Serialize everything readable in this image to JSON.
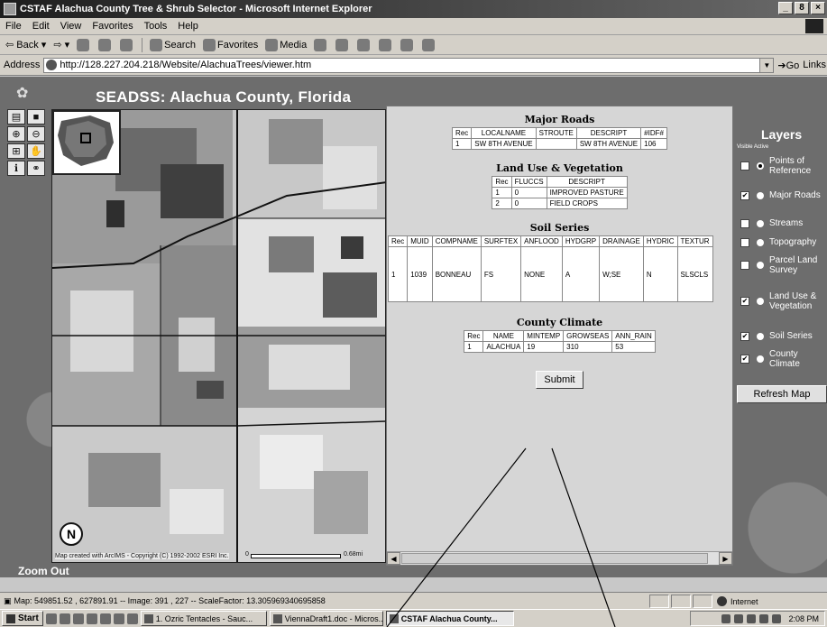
{
  "window": {
    "title": "CSTAF Alachua County Tree & Shrub Selector - Microsoft Internet Explorer",
    "controls": [
      "_",
      "8",
      "×"
    ]
  },
  "menu": [
    "File",
    "Edit",
    "View",
    "Favorites",
    "Tools",
    "Help"
  ],
  "toolbar": {
    "back": "Back",
    "search": "Search",
    "favorites": "Favorites",
    "media": "Media"
  },
  "address": {
    "label": "Address",
    "url": "http://128.227.204.218/Website/AlachuaTrees/viewer.htm",
    "go": "Go",
    "links": "Links"
  },
  "site": {
    "title": "SEADSS:  Alachua County, Florida"
  },
  "map": {
    "north": "N",
    "copyright": "Map created with ArcIMS - Copyright (C) 1992-2002 ESRI Inc.",
    "scale_start": "0",
    "scale_label": "0.68mi",
    "zoom_label": "Zoom Out"
  },
  "results": {
    "major_roads": {
      "title": "Major Roads",
      "headers": [
        "Rec",
        "LOCALNAME",
        "STROUTE",
        "DESCRIPT",
        "#IDF#"
      ],
      "rows": [
        [
          "1",
          "SW 8TH AVENUE",
          "",
          "SW 8TH AVENUE",
          "106"
        ]
      ]
    },
    "land_use": {
      "title": "Land Use & Vegetation",
      "headers": [
        "Rec",
        "FLUCCS",
        "DESCRIPT"
      ],
      "rows": [
        [
          "1",
          "0",
          "IMPROVED PASTURE"
        ],
        [
          "2",
          "0",
          "FIELD CROPS"
        ]
      ]
    },
    "soil": {
      "title": "Soil Series",
      "headers": [
        "Rec",
        "MUID",
        "COMPNAME",
        "SURFTEX",
        "ANFLOOD",
        "HYDGRP",
        "DRAINAGE",
        "HYDRIC",
        "TEXTUR"
      ],
      "rows": [
        [
          "1",
          "1039",
          "BONNEAU",
          "FS",
          "NONE",
          "A",
          "W;SE",
          "N",
          "SLSCLS"
        ]
      ]
    },
    "climate": {
      "title": "County Climate",
      "headers": [
        "Rec",
        "NAME",
        "MINTEMP",
        "GROWSEAS",
        "ANN_RAIN"
      ],
      "rows": [
        [
          "1",
          "ALACHUA",
          "19",
          "310",
          "53"
        ]
      ]
    },
    "submit": "Submit"
  },
  "layers": {
    "title": "Layers",
    "subtitle": "Visible Active",
    "items": [
      {
        "label": "Points of Reference",
        "visible": false,
        "active": true
      },
      {
        "label": "Major Roads",
        "visible": true,
        "active": false
      },
      {
        "label": "Streams",
        "visible": false,
        "active": false
      },
      {
        "label": "Topography",
        "visible": false,
        "active": false
      },
      {
        "label": "Parcel Land Survey",
        "visible": false,
        "active": false
      },
      {
        "label": "Land Use & Vegetation",
        "visible": true,
        "active": false
      },
      {
        "label": "Soil Series",
        "visible": true,
        "active": false
      },
      {
        "label": "County Climate",
        "visible": true,
        "active": false
      }
    ],
    "refresh": "Refresh Map"
  },
  "status": {
    "text": "Map: 549851.52 , 627891.91 -- Image: 391 , 227 -- ScaleFactor: 13.305969340695858",
    "zone": "Internet"
  },
  "taskbar": {
    "start": "Start",
    "tasks": [
      "1. Ozric Tentacles - Sauc...",
      "ViennaDraft1.doc - Micros...",
      "CSTAF Alachua County..."
    ],
    "clock": "2:08 PM"
  }
}
